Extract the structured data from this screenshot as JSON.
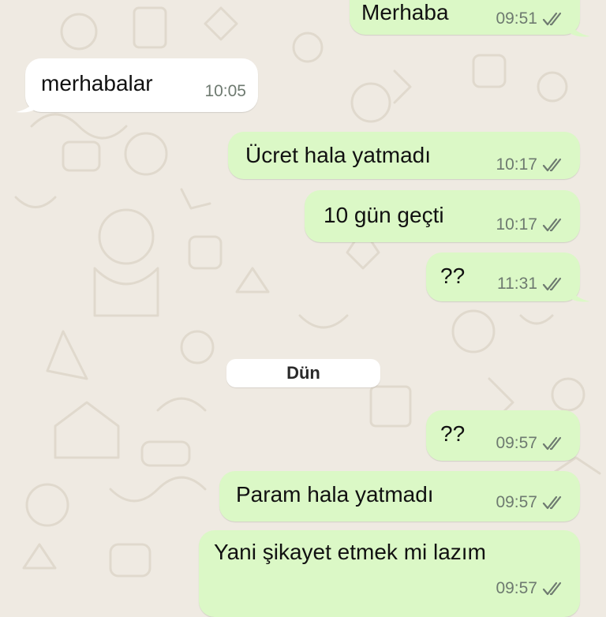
{
  "chat": {
    "date_divider": "Dün",
    "messages": [
      {
        "text": "Merhaba",
        "time": "09:51",
        "direction": "outgoing",
        "status_icon": "double-check-icon"
      },
      {
        "text": "merhabalar",
        "time": "10:05",
        "direction": "incoming"
      },
      {
        "text": "Ücret hala yatmadı",
        "time": "10:17",
        "direction": "outgoing",
        "status_icon": "double-check-icon"
      },
      {
        "text": "10 gün geçti",
        "time": "10:17",
        "direction": "outgoing",
        "status_icon": "double-check-icon"
      },
      {
        "text": "??",
        "time": "11:31",
        "direction": "outgoing",
        "status_icon": "double-check-icon"
      },
      {
        "text": "??",
        "time": "09:57",
        "direction": "outgoing",
        "status_icon": "double-check-icon"
      },
      {
        "text": "Param hala yatmadı",
        "time": "09:57",
        "direction": "outgoing",
        "status_icon": "double-check-icon"
      },
      {
        "text": "Yani şikayet etmek mi lazım",
        "time": "09:57",
        "direction": "outgoing",
        "status_icon": "double-check-icon"
      }
    ]
  },
  "colors": {
    "outgoing_bubble": "#dbf8c6",
    "incoming_bubble": "#ffffff",
    "chat_background": "#efeae2",
    "timestamp": "#6e7a70"
  }
}
